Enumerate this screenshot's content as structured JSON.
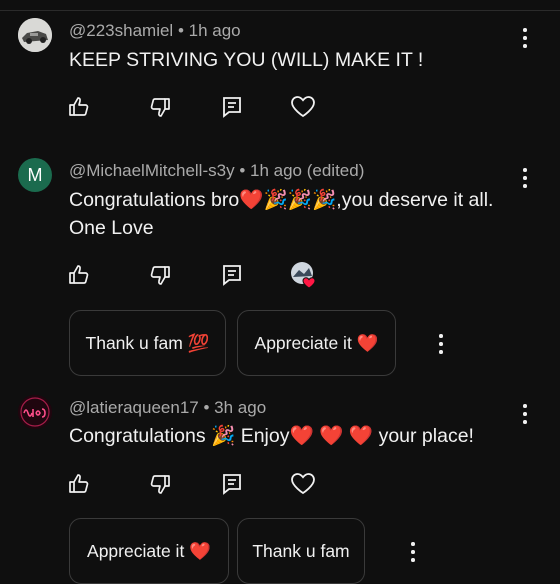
{
  "comments": [
    {
      "handle": "@223shamiel",
      "time": "1h ago",
      "text": "KEEP STRIVING YOU (WILL) MAKE IT !",
      "avatar_icon": "car-photo-avatar"
    },
    {
      "handle": "@MichaelMitchell-s3y",
      "time": "1h ago (edited)",
      "text": "Congratulations bro❤️🎉🎉🎉,you deserve it all. One Love",
      "avatar_letter": "M",
      "avatar_color": "#1b6b4e",
      "creator_heart_icon": "creator-heart-icon",
      "reply_chips": [
        "Thank u fam 💯",
        "Appreciate it ❤️"
      ]
    },
    {
      "handle": "@latieraqueen17",
      "time": "3h ago",
      "text": "Congratulations 🎉 Enjoy❤️ ❤️ ❤️ your place!",
      "avatar_icon": "neon-sign-avatar",
      "reply_chips": [
        "Appreciate it ❤️",
        "Thank u fam"
      ]
    }
  ],
  "separator": "•",
  "icons": {
    "like": "thumbs-up-icon",
    "dislike": "thumbs-down-icon",
    "reply": "reply-icon",
    "heart": "heart-icon",
    "more": "more-vert-icon"
  }
}
